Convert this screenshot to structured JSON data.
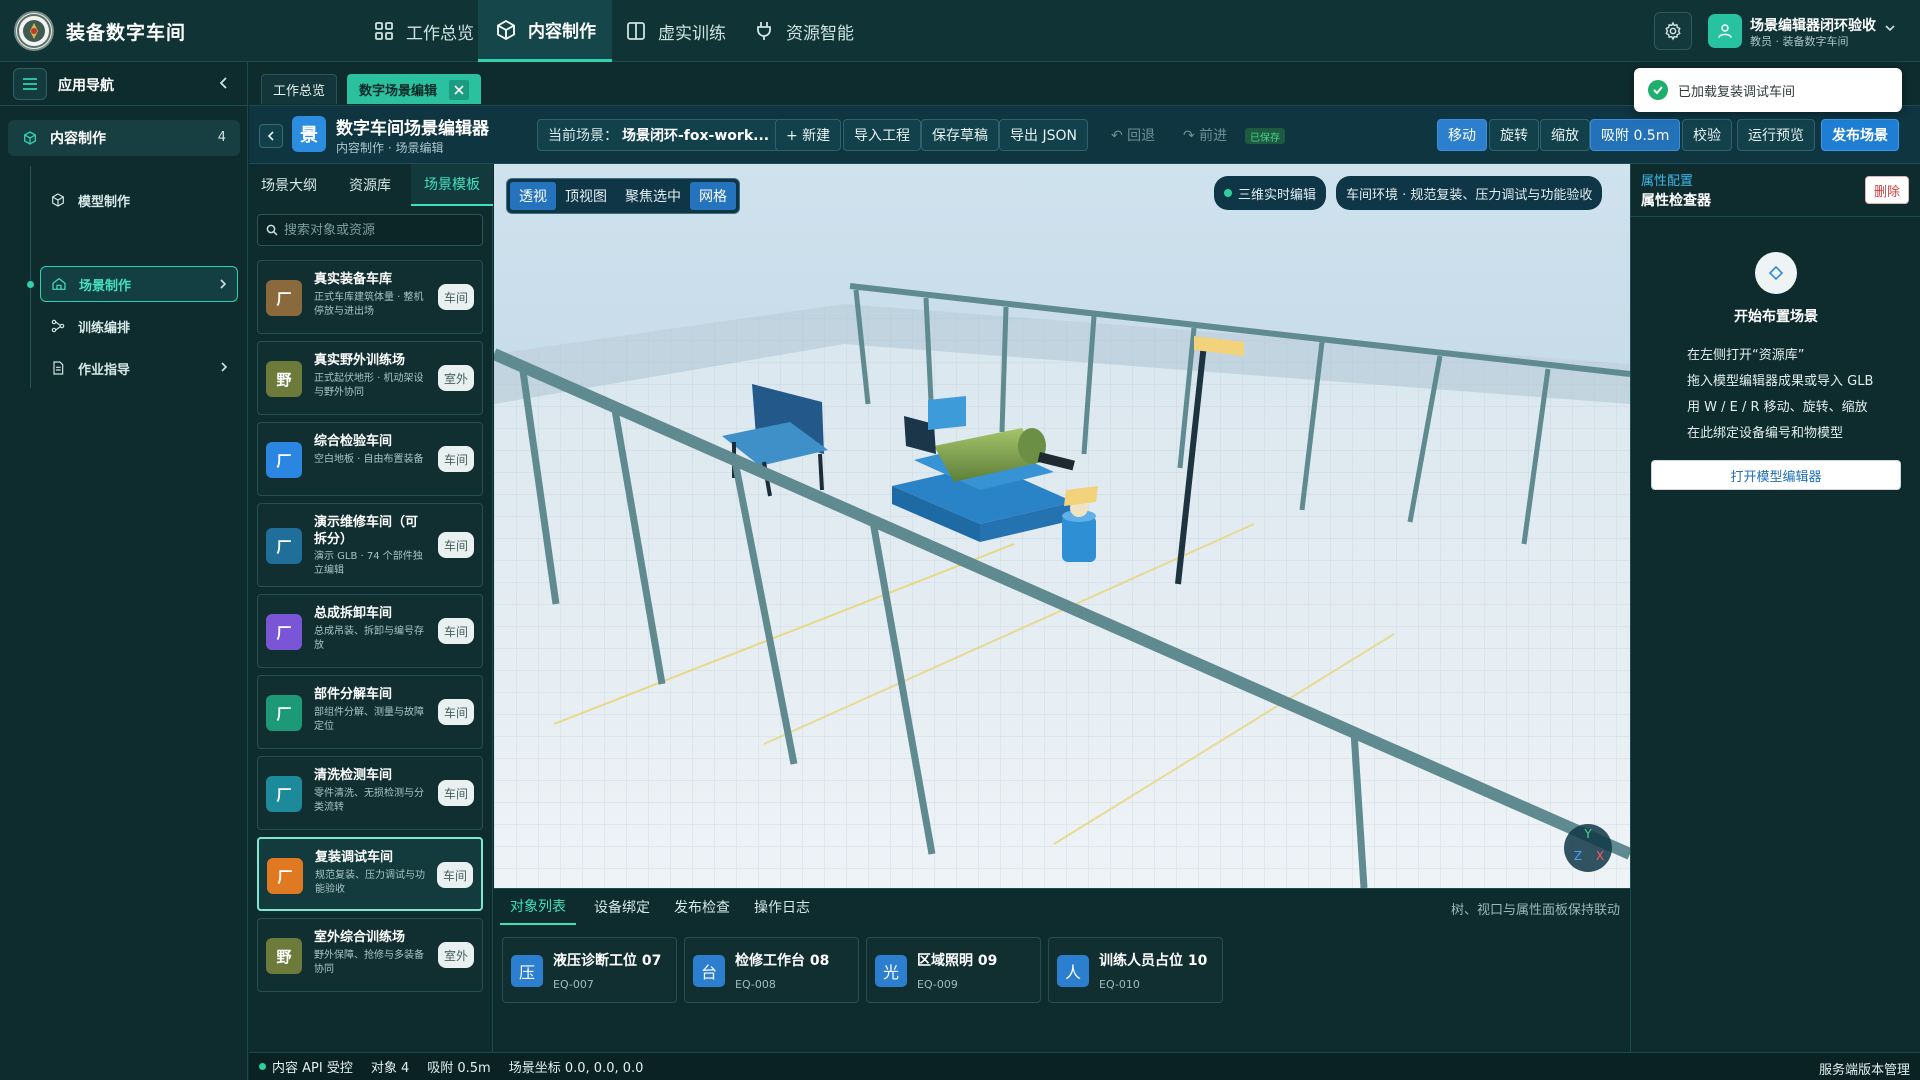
{
  "app": {
    "title": "装备数字车间"
  },
  "topnav": [
    {
      "label": "工作总览",
      "icon": "grid-icon"
    },
    {
      "label": "内容制作",
      "icon": "cube-icon"
    },
    {
      "label": "虚实训练",
      "icon": "book-icon"
    },
    {
      "label": "资源智能",
      "icon": "plug-icon"
    }
  ],
  "user": {
    "name": "场景编辑器闭环验收",
    "role": "教员 · 装备数字车间"
  },
  "leftnav": {
    "title": "应用导航",
    "group": {
      "label": "内容制作",
      "count": "4"
    },
    "items": [
      {
        "label": "模型制作",
        "icon": "cube-icon"
      },
      {
        "label": "场景制作",
        "icon": "home-icon"
      },
      {
        "label": "训练编排",
        "icon": "flow-icon"
      },
      {
        "label": "作业指导",
        "icon": "doc-icon"
      }
    ]
  },
  "tabs": [
    {
      "label": "工作总览"
    },
    {
      "label": "数字场景编辑"
    }
  ],
  "toast": {
    "text": "已加载复装调试车间"
  },
  "editor": {
    "title": "数字车间场景编辑器",
    "breadcrumb": "内容制作 · 场景编辑",
    "scene_label": "当前场景：",
    "scene_value": "场景闭环-fox-work...",
    "buttons": {
      "new": "+ 新建",
      "import": "导入工程",
      "save": "保存草稿",
      "export": "导出 JSON",
      "undo": "↶ 回退",
      "redo": "↷ 前进",
      "saved": "已保存",
      "move": "移动",
      "rotate": "旋转",
      "scale": "缩放",
      "snap": "吸附 0.5m",
      "validate": "校验",
      "preview": "运行预览",
      "publish": "发布场景"
    }
  },
  "leftpanel": {
    "tabs": [
      "场景大纲",
      "资源库",
      "场景模板"
    ],
    "search_placeholder": "搜索对象或资源",
    "templates": [
      {
        "icon": "厂",
        "name": "真实装备车库",
        "desc": "正式车库建筑体量 · 整机停放与进出场",
        "badge": "车间",
        "color": "#8a6a3c"
      },
      {
        "icon": "野",
        "name": "真实野外训练场",
        "desc": "正式起伏地形 · 机动架设与野外协同",
        "badge": "室外",
        "color": "#6c7a3a"
      },
      {
        "icon": "厂",
        "name": "综合检验车间",
        "desc": "空白地板 · 自由布置装备",
        "badge": "车间",
        "color": "#2a86e0"
      },
      {
        "icon": "厂",
        "name": "演示维修车间（可拆分）",
        "desc": "演示 GLB · 74 个部件独立编辑",
        "badge": "车间",
        "color": "#1f6f9a"
      },
      {
        "icon": "厂",
        "name": "总成拆卸车间",
        "desc": "总成吊装、拆卸与编号存放",
        "badge": "车间",
        "color": "#7a55d6"
      },
      {
        "icon": "厂",
        "name": "部件分解车间",
        "desc": "部组件分解、测量与故障定位",
        "badge": "车间",
        "color": "#1c9a78"
      },
      {
        "icon": "厂",
        "name": "清洗检测车间",
        "desc": "零件清洗、无损检测与分类流转",
        "badge": "车间",
        "color": "#1c8a9a"
      },
      {
        "icon": "厂",
        "name": "复装调试车间",
        "desc": "规范复装、压力调试与功能验收",
        "badge": "车间",
        "color": "#e07a22"
      },
      {
        "icon": "野",
        "name": "室外综合训练场",
        "desc": "野外保障、抢修与多装备协同",
        "badge": "室外",
        "color": "#6c7a3a"
      }
    ]
  },
  "viewport": {
    "tools": [
      "透视",
      "顶视图",
      "聚焦选中",
      "网格"
    ],
    "chip_live": "三维实时编辑",
    "chip_env": "车间环境 · 规范复装、压力调试与功能验收",
    "gizmo": {
      "y": "Y",
      "z": "Z",
      "x": "X"
    }
  },
  "bottompanel": {
    "tabs": [
      "对象列表",
      "设备绑定",
      "发布检查",
      "操作日志"
    ],
    "hint": "树、视口与属性面板保持联动",
    "objects": [
      {
        "icon": "压",
        "name": "液压诊断工位 07",
        "code": "EQ-007"
      },
      {
        "icon": "台",
        "name": "检修工作台 08",
        "code": "EQ-008"
      },
      {
        "icon": "光",
        "name": "区域照明 09",
        "code": "EQ-009"
      },
      {
        "icon": "人",
        "name": "训练人员占位 10",
        "code": "EQ-010"
      }
    ]
  },
  "rightpanel": {
    "kicker": "属性配置",
    "title": "属性检查器",
    "delete": "删除",
    "empty_title": "开始布置场景",
    "lines": [
      "在左侧打开“资源库”",
      "拖入模型编辑器成果或导入 GLB",
      "用 W / E / R 移动、旋转、缩放",
      "在此绑定设备编号和物模型"
    ],
    "open_button": "打开模型编辑器"
  },
  "status": {
    "api": "内容 API 受控",
    "objects": "对象 4",
    "snap": "吸附 0.5m",
    "coords": "场景坐标 0.0, 0.0, 0.0",
    "right": "服务端版本管理"
  },
  "colors": {
    "accent": "#2fd1ae",
    "brand_blue": "#2371b9",
    "danger": "#d23e3e"
  }
}
